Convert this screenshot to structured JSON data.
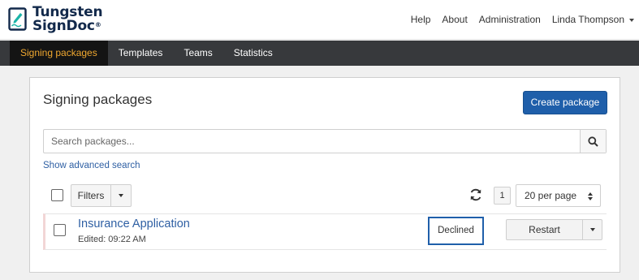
{
  "logo": {
    "line1": "Tungsten",
    "line2": "SignDoc",
    "mark": "®"
  },
  "top_nav": {
    "help": "Help",
    "about": "About",
    "administration": "Administration",
    "user": "Linda Thompson"
  },
  "main_nav": [
    {
      "label": "Signing packages",
      "active": true
    },
    {
      "label": "Templates",
      "active": false
    },
    {
      "label": "Teams",
      "active": false
    },
    {
      "label": "Statistics",
      "active": false
    }
  ],
  "panel": {
    "title": "Signing packages",
    "create_button": "Create package",
    "search_placeholder": "Search packages...",
    "search_value": "",
    "advanced_search": "Show advanced search",
    "filters_label": "Filters",
    "page_number": "1",
    "per_page": "20 per page"
  },
  "packages": [
    {
      "title": "Insurance Application",
      "edited": "Edited: 09:22 AM",
      "status": "Declined",
      "action": "Restart"
    }
  ],
  "colors": {
    "primary": "#1f5faa",
    "nav_bg": "#37393c",
    "nav_active": "#f0a830",
    "link": "#2e5fa3",
    "brand": "#12294b"
  },
  "icons": {
    "logo": "pen-sign-icon",
    "search": "search-icon",
    "refresh": "refresh-icon",
    "caret": "caret-down-icon",
    "sort": "updown-icon"
  }
}
